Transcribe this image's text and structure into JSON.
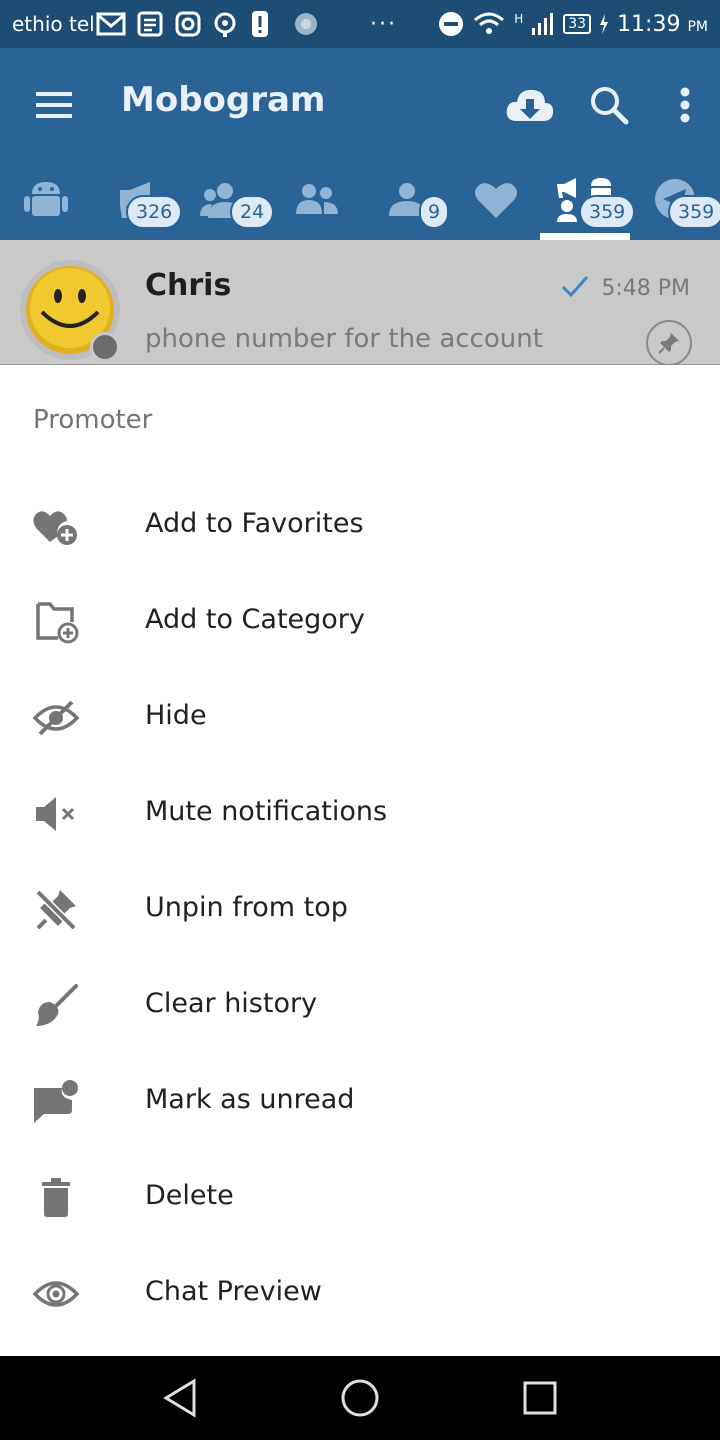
{
  "status_bar": {
    "carrier": "ethio tel",
    "dots": "···",
    "network_label": "H",
    "battery": "33",
    "time": "11:39",
    "ampm": "PM"
  },
  "app_bar": {
    "title": "Mobogram",
    "icons": [
      "menu-icon",
      "cloud-download-icon",
      "search-icon",
      "more-vert-icon"
    ]
  },
  "tabs": [
    {
      "icon": "android-icon",
      "badge": ""
    },
    {
      "icon": "megaphone-icon",
      "badge": "326"
    },
    {
      "icon": "group-icon",
      "badge": "24"
    },
    {
      "icon": "contacts-icon",
      "badge": ""
    },
    {
      "icon": "user-icon",
      "badge": "9"
    },
    {
      "icon": "heart-icon",
      "badge": ""
    },
    {
      "icon": "bot-channel-icon",
      "badge": "359",
      "selected": true
    },
    {
      "icon": "telegram-icon",
      "badge": "359"
    }
  ],
  "chat": {
    "name": "Chris",
    "time": "5:48 PM",
    "preview": "phone number for the account"
  },
  "sheet": {
    "title": "Promoter",
    "items": [
      {
        "label": "Add to Favorites",
        "icon": "heart-add-icon"
      },
      {
        "label": "Add to Category",
        "icon": "folder-add-icon"
      },
      {
        "label": "Hide",
        "icon": "eye-off-icon"
      },
      {
        "label": "Mute notifications",
        "icon": "volume-mute-icon"
      },
      {
        "label": "Unpin from top",
        "icon": "unpin-icon"
      },
      {
        "label": "Clear history",
        "icon": "broom-icon"
      },
      {
        "label": "Mark as unread",
        "icon": "message-unread-icon"
      },
      {
        "label": "Delete",
        "icon": "trash-icon"
      },
      {
        "label": "Chat Preview",
        "icon": "eye-icon"
      }
    ]
  },
  "colors": {
    "status_bar": "#1d4d74",
    "app_bar": "#2a6497",
    "dim_row": "#c9c9c9",
    "icon_gray": "#757575"
  }
}
